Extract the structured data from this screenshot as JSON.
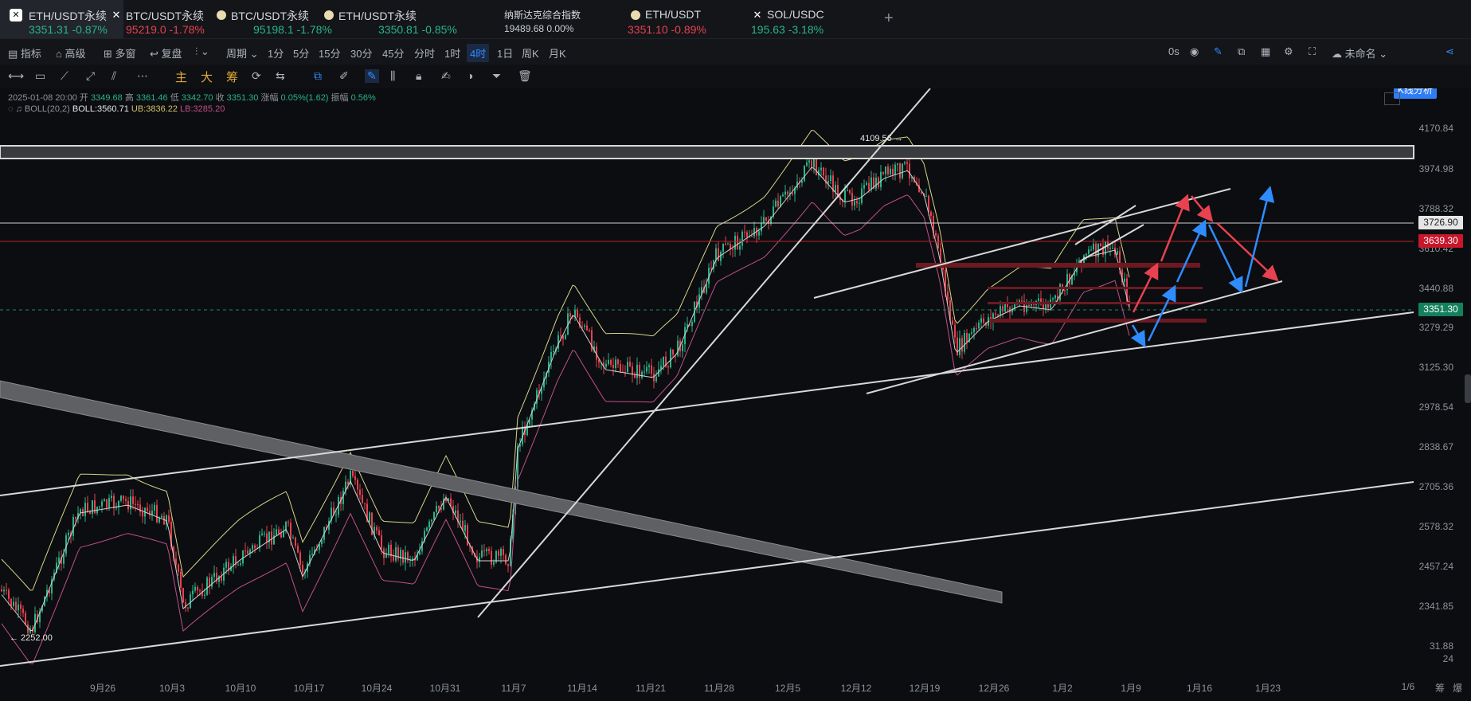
{
  "tabs": [
    {
      "name": "ETH/USDT永续",
      "price": "3351.31",
      "change": "-0.87%",
      "dir": "up",
      "icon": "okx-logo"
    },
    {
      "name": "BTC/USDT永续",
      "price": "95219.0",
      "change": "-1.78%",
      "dir": "down",
      "icon": "x-logo"
    },
    {
      "name": "BTC/USDT永续",
      "price": "95198.1",
      "change": "-1.78%",
      "dir": "up",
      "icon": "coin"
    },
    {
      "name": "ETH/USDT永续",
      "price": "3350.81",
      "change": "-0.85%",
      "dir": "up",
      "icon": "coin"
    },
    {
      "name": "纳斯达克综合指数",
      "price": "19489.68",
      "change": "0.00%",
      "dir": "neutral",
      "icon": "none"
    },
    {
      "name": "ETH/USDT",
      "price": "3351.10",
      "change": "-0.89%",
      "dir": "down",
      "icon": "coin"
    },
    {
      "name": "SOL/USDC",
      "price": "195.63",
      "change": "-3.18%",
      "dir": "up",
      "icon": "x-logo"
    }
  ],
  "toolbar": {
    "indicator": "指标",
    "advanced": "高级",
    "multi": "多窗",
    "replay": "复盘",
    "period": "周期",
    "intervals": [
      "1分",
      "5分",
      "15分",
      "30分",
      "45分",
      "分时",
      "1时",
      "4时",
      "1日",
      "周K",
      "月K"
    ],
    "selected_interval": "4时",
    "seconds": "0s",
    "account": "未命名",
    "kline_analysis": "K线分析"
  },
  "toolbar2": {
    "main": "主",
    "big": "大",
    "chip": "筹"
  },
  "info": {
    "datetime": "2025-01-08 20:00",
    "open_label": "开",
    "open": "3349.68",
    "high_label": "高",
    "high": "3361.46",
    "low_label": "低",
    "low": "3342.70",
    "close_label": "收",
    "close": "3351.30",
    "change_label": "涨幅",
    "change": "0.05%(1.62)",
    "amp_label": "振幅",
    "amp": "0.56%",
    "boll_label": "BOLL(20,2)",
    "boll": "BOLL:3560.71",
    "ub": "UB:3836.22",
    "lb": "LB:3285.20"
  },
  "y_axis": [
    "4170.84",
    "3974.98",
    "3788.32",
    "3610.42",
    "3440.88",
    "3279.29",
    "3125.30",
    "2978.54",
    "2838.67",
    "2705.36",
    "2578.32",
    "2457.24",
    "2341.85",
    "31.88",
    "24"
  ],
  "price_tags": {
    "white": "3726.90",
    "red": "3639.30",
    "green": "3351.30"
  },
  "x_axis": [
    "9月26",
    "10月3",
    "10月10",
    "10月17",
    "10月24",
    "10月31",
    "11月7",
    "11月14",
    "11月21",
    "11月28",
    "12月5",
    "12月12",
    "12月19",
    "12月26",
    "1月2",
    "1月9",
    "1月16",
    "1月23",
    "1/6",
    "筹",
    "爆"
  ],
  "annotations": {
    "high": "4109.56 →",
    "low": "← 2252.00"
  },
  "colors": {
    "up": "#27b48a",
    "down": "#e8414f",
    "accent": "#2f8cff",
    "boll_upper": "#d6d48a",
    "boll_lower": "#c0508a"
  }
}
